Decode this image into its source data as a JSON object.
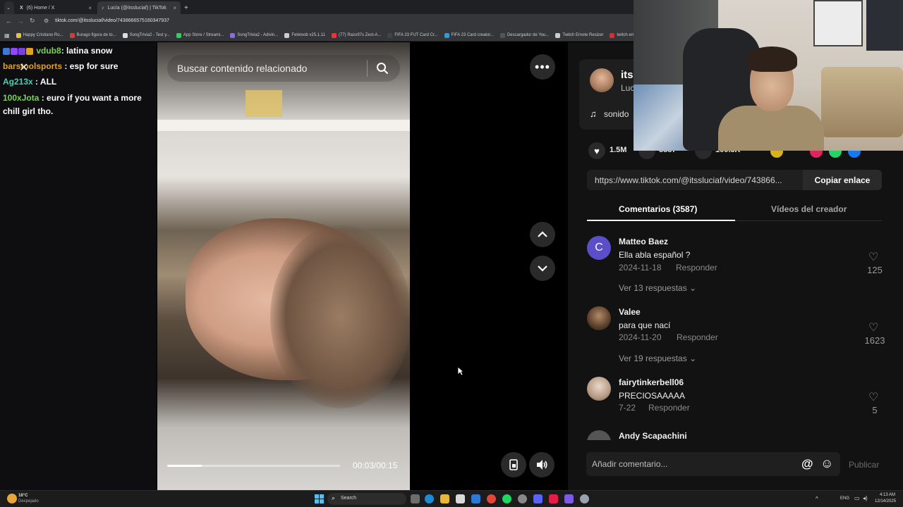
{
  "browser": {
    "tabs": [
      {
        "title": "(6) Home / X",
        "active": false
      },
      {
        "title": "Lucía (@itssluciaf) | TikTok",
        "active": true
      }
    ],
    "url": "tiktok.com/@itssluciaf/video/7438666575160347937",
    "bookmarks": [
      {
        "label": "Happy Cristiano Ro...",
        "color": "#e8c23c"
      },
      {
        "label": "Burago figura de to...",
        "color": "#d83a2f"
      },
      {
        "label": "SongTrivia2 - Test y...",
        "color": "#ddd"
      },
      {
        "label": "App Store / Streami...",
        "color": "#3cc860"
      },
      {
        "label": "SongTrivia2 - Adivin...",
        "color": "#8a6ce0"
      },
      {
        "label": "Feletoob v25.1.11",
        "color": "#ccc"
      },
      {
        "label": "(77) Razo97s Zest-A...",
        "color": "#e33"
      },
      {
        "label": "FIFA 23 FUT Card Cr...",
        "color": "#444"
      },
      {
        "label": "FIFA 23 Card creator...",
        "color": "#2e9bd6"
      },
      {
        "label": "Descargador de You...",
        "color": "#555"
      },
      {
        "label": "Twitch Emote Resizer",
        "color": "#ccc"
      },
      {
        "label": "twitch em",
        "color": "#c33"
      }
    ]
  },
  "chat": [
    {
      "user": "vdub8",
      "color": "#7cd15a",
      "message": "latina snow"
    },
    {
      "user": "barstoolsports",
      "color": "#e3a21a",
      "message": "esp for sure"
    },
    {
      "user": "Ag213x",
      "color": "#41d3b4",
      "message": "ALL"
    },
    {
      "user": "100xJota",
      "color": "#7cd15a",
      "message": "euro if you want a more chill girl tho."
    }
  ],
  "video": {
    "search_placeholder": "Buscar contenido relacionado",
    "time": "00:03/00:15",
    "progress": 0.2
  },
  "creator": {
    "handle_partial": "its",
    "name_partial": "Luc",
    "sound_partial": "sonido"
  },
  "stats": {
    "likes": "1.5M",
    "comments": "3587",
    "saves": "100.3K"
  },
  "share": {
    "link": "https://www.tiktok.com/@itssluciaf/video/743866...",
    "copy_label": "Copiar enlace"
  },
  "tabs": {
    "comments": "Comentarios (3587)",
    "creator_videos": "Vídeos del creador"
  },
  "comments": [
    {
      "user": "Matteo Baez",
      "initial": "C",
      "text": "Ella abla español ?",
      "date": "2024-11-18",
      "reply": "Responder",
      "likes": "125",
      "more": "Ver 13 respuestas"
    },
    {
      "user": "Valee",
      "initial": "",
      "text": "para que nací",
      "date": "2024-11-20",
      "reply": "Responder",
      "likes": "1623",
      "more": "Ver 19 respuestas"
    },
    {
      "user": "fairytinkerbell06",
      "initial": "",
      "text": "PRECIOSAAAAA",
      "date": "7-22",
      "reply": "Responder",
      "likes": "5",
      "more": ""
    },
    {
      "user": "Andy Scapachini",
      "initial": "",
      "text": "",
      "date": "",
      "reply": "",
      "likes": "",
      "more": ""
    }
  ],
  "comment_input": {
    "placeholder": "Añadir comentario...",
    "publish": "Publicar"
  },
  "taskbar": {
    "weather_temp": "18°C",
    "weather_desc": "Despejado",
    "search": "Search",
    "lang": "ENG",
    "time": "4:13 AM",
    "date": "12/14/2025"
  }
}
